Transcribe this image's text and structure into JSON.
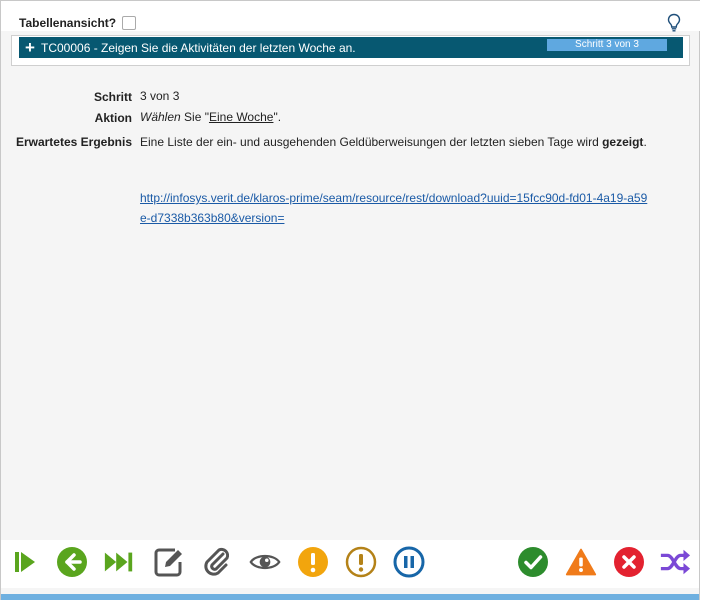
{
  "table_view": {
    "label": "Tabellenansicht?",
    "checked": false
  },
  "testcase": {
    "plus": "+",
    "title": "TC00006 - Zeigen Sie die Aktivitäten der letzten Woche an.",
    "step_badge": "Schritt 3 von 3"
  },
  "details": {
    "step_label": "Schritt",
    "step_value": "3 von 3",
    "action_label": "Aktion",
    "action_prefix_italic": "Wählen",
    "action_middle": " Sie \"",
    "action_link": "Eine Woche",
    "action_suffix": "\".",
    "expected_label": "Erwartetes Ergebnis",
    "expected_text_1": "Eine Liste der ein- und ausgehenden Geldüberweisungen der letzten sieben Tage wird ",
    "expected_text_bold": "gezeigt",
    "expected_text_2": ".",
    "attachment_url_line1": "http://infosys.verit.de/klaros-prime/seam/resource/rest/download?uuid=15fcc90d-fd01-4a19-a59",
    "attachment_url_line2": "e-d7338b363b80&version="
  },
  "toolbar": {
    "buttons": [
      "play-step-icon",
      "back-icon",
      "skip-forward-icon",
      "edit-icon",
      "attach-icon",
      "eye-icon",
      "warning-circle-icon",
      "warning-outline-icon",
      "pause-icon",
      "pass-icon",
      "error-triangle-icon",
      "fail-icon",
      "shuffle-icon"
    ]
  },
  "colors": {
    "header_bg": "#075871",
    "badge_bg": "#5fa8e0",
    "green": "#5aa51e",
    "dark_green": "#2d8c2d",
    "orange": "#f2a50d",
    "brown": "#b48218",
    "blue": "#1766a8",
    "red": "#e32230",
    "purple": "#7b49d6",
    "gray_icon": "#555555"
  }
}
